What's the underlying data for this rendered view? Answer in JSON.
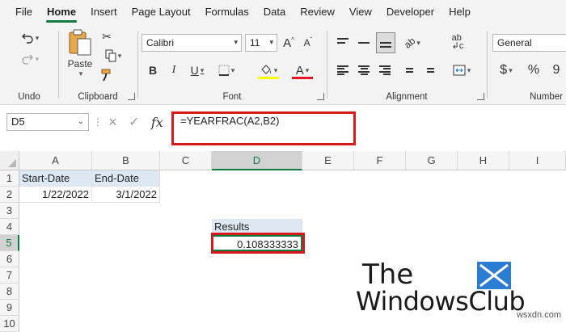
{
  "menu": {
    "tabs": [
      "File",
      "Home",
      "Insert",
      "Page Layout",
      "Formulas",
      "Data",
      "Review",
      "View",
      "Developer",
      "Help"
    ],
    "active": "Home"
  },
  "ribbon": {
    "undo_group": "Undo",
    "clipboard": {
      "paste_label": "Paste",
      "group_label": "Clipboard"
    },
    "font": {
      "name": "Calibri",
      "size": "11",
      "group_label": "Font",
      "bold": "B",
      "italic": "I",
      "underline": "U",
      "font_color_letter": "A",
      "grow": "A",
      "shrink": "A"
    },
    "alignment": {
      "group_label": "Alignment"
    },
    "number": {
      "format": "General",
      "group_label": "Number",
      "currency": "$",
      "percent": "%"
    }
  },
  "formula_bar": {
    "name_box": "D5",
    "cancel_icon": "×",
    "enter_icon": "✓",
    "fx_label": "fx",
    "formula": "=YEARFRAC(A2,B2)"
  },
  "grid": {
    "columns": [
      "A",
      "B",
      "C",
      "D",
      "E",
      "F",
      "G",
      "H",
      "I"
    ],
    "rows": [
      "1",
      "2",
      "3",
      "4",
      "5",
      "6",
      "7",
      "8",
      "9",
      "10"
    ],
    "cells": {
      "A1": "Start-Date",
      "B1": "End-Date",
      "A2": "1/22/2022",
      "B2": "3/1/2022",
      "D4": "Results",
      "D5": "0.108333333"
    },
    "selected_cell": "D5"
  },
  "watermark": {
    "line1": "The",
    "line2": "WindowsClub"
  },
  "credit": "wsxdn.com",
  "colors": {
    "accent": "#107c41",
    "highlight_box": "#d9181b",
    "header_fill": "#dde8f3"
  }
}
